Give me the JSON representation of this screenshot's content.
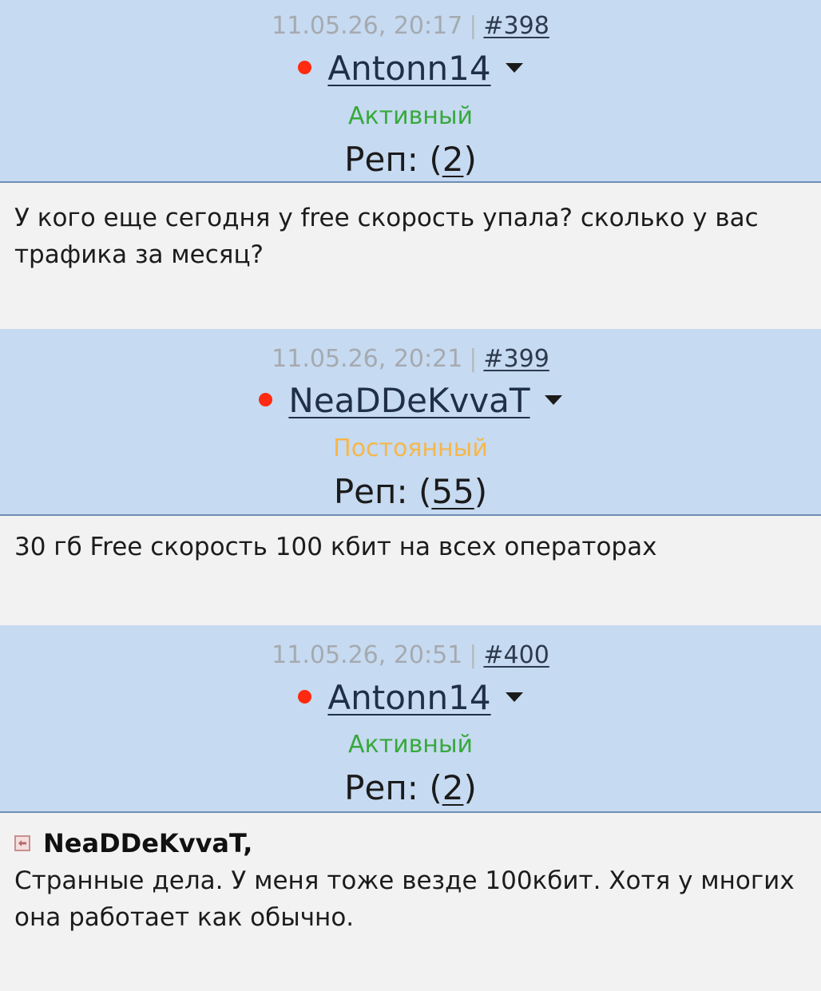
{
  "posts": [
    {
      "date": "11.05.26, 20:17",
      "separator": "|",
      "number": "#398",
      "author": "Antonn14",
      "rank": "Активный",
      "rank_color": "#36a93a",
      "rep_label": "Реп:",
      "rep_open": "(",
      "rep_value": "2",
      "rep_close": ")",
      "text": "У кого еще сегодня у free скорость упала? сколько у вас трафика за месяц?"
    },
    {
      "date": "11.05.26, 20:21",
      "separator": "|",
      "number": "#399",
      "author": "NeaDDeKvvaT",
      "rank": "Постоянный",
      "rank_color": "#f5b74a",
      "rep_label": "Реп:",
      "rep_open": "(",
      "rep_value": "55",
      "rep_close": ")",
      "text": "30 гб Free скорость 100 кбит на всех операторах"
    },
    {
      "date": "11.05.26, 20:51",
      "separator": "|",
      "number": "#400",
      "author": "Antonn14",
      "rank": "Активный",
      "rank_color": "#36a93a",
      "rep_label": "Реп:",
      "rep_open": "(",
      "rep_value": "2",
      "rep_close": ")",
      "quote_to": "NeaDDeKvvaT,",
      "text": "Странные дела. У меня тоже везде 100кбит. Хотя у многих она работает как обычно."
    }
  ],
  "colors": {
    "header_bg": "#c6daf1",
    "body_bg": "#f2f2f2",
    "online_dot": "#ff2a10"
  },
  "icons": {
    "status": "online-dot-icon",
    "menu": "caret-down-icon",
    "reply": "reply-arrow-icon"
  }
}
